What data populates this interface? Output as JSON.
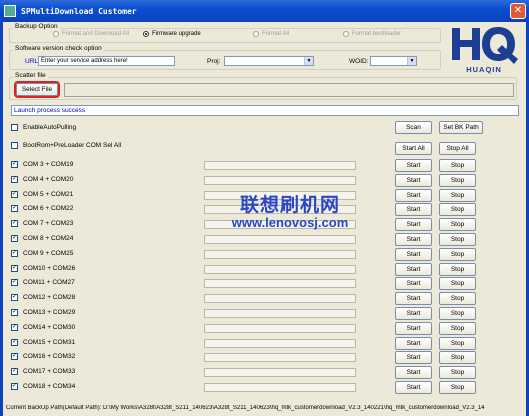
{
  "window": {
    "title": "SPMultiDownload Customer",
    "close_glyph": "✕"
  },
  "backup_option": {
    "label": "Backup Option",
    "options": [
      {
        "label": "Format and Download All",
        "selected": false
      },
      {
        "label": "Firmware upgrade",
        "selected": true
      },
      {
        "label": "Format All",
        "selected": false
      },
      {
        "label": "Format bootloader",
        "selected": false
      }
    ]
  },
  "version_check": {
    "label": "Software version check option",
    "url_label": "URL:",
    "url_value": "Enter your service address here!",
    "proj_label": "Proj:",
    "proj_value": "",
    "woid_label": "WOID:",
    "woid_value": ""
  },
  "scatter": {
    "label": "Scatter file",
    "select_button": "Select File",
    "path": ""
  },
  "status_text": "Launch process success",
  "options": {
    "enable_auto_pulling": {
      "label": "EnableAutoPulling",
      "checked": false
    },
    "bootrom_preloader": {
      "label": "BootRom+PreLoader COM Sel All",
      "checked": false
    }
  },
  "buttons": {
    "scan": "Scan",
    "set_bk_path": "Set BK Path",
    "start_all": "Start All",
    "stop_all": "Stop All",
    "start": "Start",
    "stop": "Stop"
  },
  "ports": [
    {
      "label": "COM 3 + COM19",
      "checked": true,
      "progress": 0
    },
    {
      "label": "COM 4 + COM20",
      "checked": true,
      "progress": 0
    },
    {
      "label": "COM 5 + COM21",
      "checked": true,
      "progress": 0
    },
    {
      "label": "COM 6 + COM22",
      "checked": true,
      "progress": 0
    },
    {
      "label": "COM 7 + COM23",
      "checked": true,
      "progress": 0
    },
    {
      "label": "COM 8 + COM24",
      "checked": true,
      "progress": 0
    },
    {
      "label": "COM 9 + COM25",
      "checked": true,
      "progress": 0
    },
    {
      "label": "COM10 + COM26",
      "checked": true,
      "progress": 0
    },
    {
      "label": "COM11 + COM27",
      "checked": true,
      "progress": 0
    },
    {
      "label": "COM12 + COM28",
      "checked": true,
      "progress": 0
    },
    {
      "label": "COM13 + COM29",
      "checked": true,
      "progress": 0
    },
    {
      "label": "COM14 + COM30",
      "checked": true,
      "progress": 0
    },
    {
      "label": "COM15 + COM31",
      "checked": true,
      "progress": 0
    },
    {
      "label": "COM16 + COM32",
      "checked": true,
      "progress": 0
    },
    {
      "label": "COM17 + COM33",
      "checked": true,
      "progress": 0
    },
    {
      "label": "COM18 + COM34",
      "checked": true,
      "progress": 0
    }
  ],
  "check_glyph": "✓",
  "watermark": {
    "title": "联想刷机网",
    "url": "www.lenovosj.com"
  },
  "logo": {
    "text": "HUAQIN"
  },
  "footer": "Current BackUp Path(Default Path):  D:\\My Works\\A328t\\A328t_S211_140623\\A328t_S211_140623\\hq_mtk_customerdownload_V2.3_140221\\hq_mtk_customerdownload_V2.3_14",
  "colors": {
    "title_bar": "#0a4fd1",
    "status_text": "#0000c8",
    "watermark": "#2a46c9",
    "logo_blue": "#1c3f94"
  }
}
